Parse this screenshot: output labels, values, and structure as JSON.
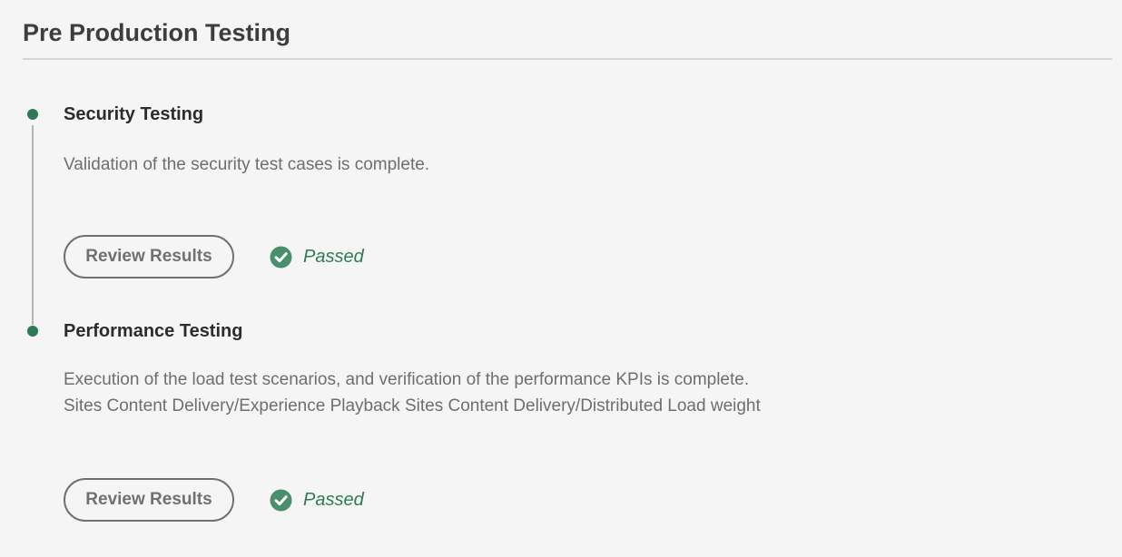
{
  "page": {
    "title": "Pre Production Testing"
  },
  "steps": [
    {
      "title": "Security Testing",
      "description_lines": [
        "Validation of the security test cases is complete."
      ],
      "button_label": "Review Results",
      "status": "Passed"
    },
    {
      "title": "Performance Testing",
      "description_lines": [
        "Execution of the load test scenarios, and verification of the performance KPIs is complete.",
        "Sites Content Delivery/Experience Playback Sites Content Delivery/Distributed Load weight"
      ],
      "button_label": "Review Results",
      "status": "Passed"
    }
  ],
  "colors": {
    "accent_green": "#2d7a59",
    "status_icon_green": "#4a8f6c",
    "timeline_line": "#b4b4b4"
  },
  "icons": {
    "status_passed": "checkmark-circle-icon",
    "step_marker": "timeline-dot-icon"
  }
}
